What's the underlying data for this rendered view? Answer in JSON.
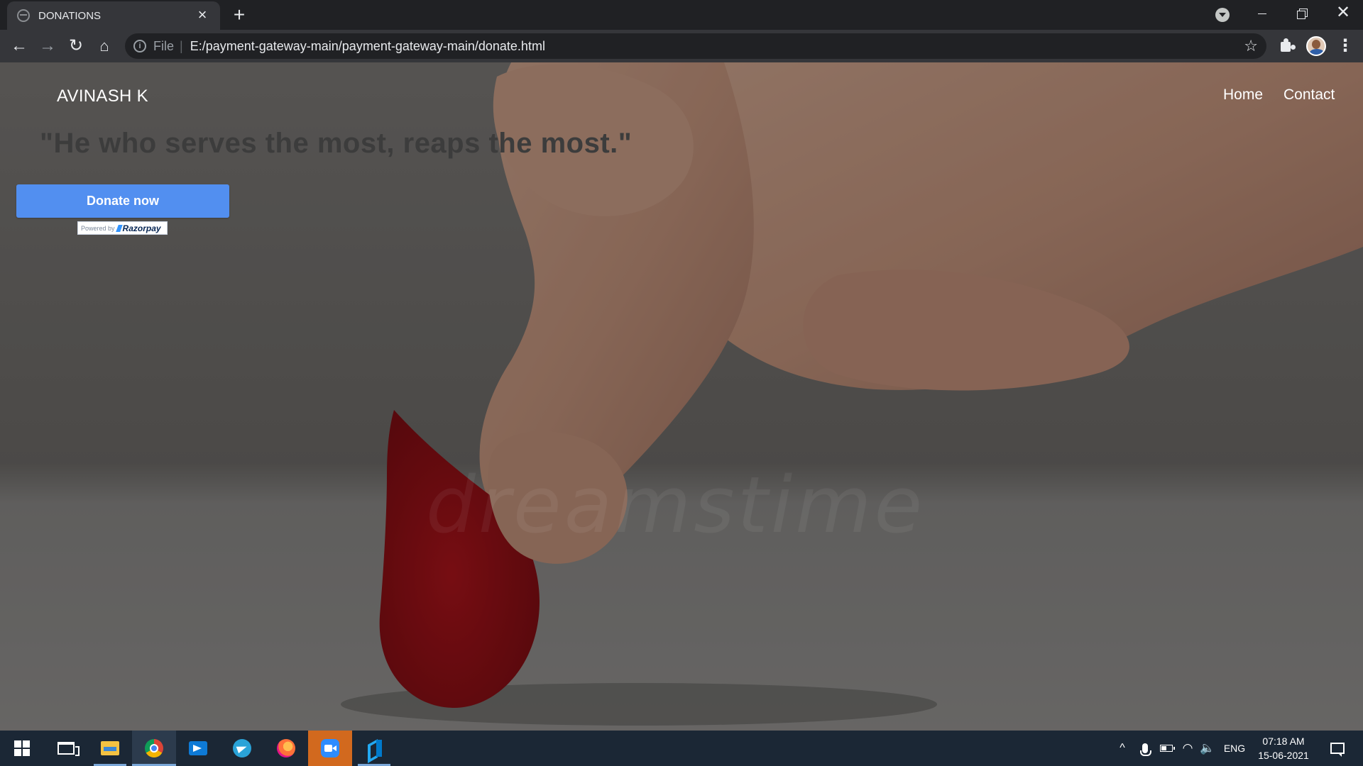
{
  "browser": {
    "tab": {
      "title": "DONATIONS",
      "close_glyph": "×"
    },
    "new_tab_glyph": "+",
    "omnibox": {
      "scheme_label": "File",
      "separator": "|",
      "url": "E:/payment-gateway-main/payment-gateway-main/donate.html"
    },
    "icons": {
      "back": "←",
      "forward": "→",
      "reload": "↻",
      "home": "⌂",
      "info": "i",
      "star": "☆",
      "menu": "⋮",
      "close": "✕"
    }
  },
  "page": {
    "brand": "AVINASH K",
    "nav": {
      "home": "Home",
      "contact": "Contact"
    },
    "quote": "\"He who serves the most, reaps the most.\"",
    "donate_button": "Donate now",
    "razorpay_badge": {
      "powered_by": "Powered by",
      "logo_text": "Razorpay"
    },
    "watermark": "dreamstime"
  },
  "taskbar": {
    "apps": [
      "start",
      "task-view",
      "file-explorer",
      "chrome",
      "remote-desktop",
      "telegram",
      "firefox",
      "zoom",
      "vscode"
    ],
    "active_app": "chrome",
    "tray": {
      "chevron": "^",
      "wifi_glyph": "◠",
      "volume_glyph": "🔈",
      "language": "ENG",
      "time": "07:18 AM",
      "date": "15-06-2021"
    }
  },
  "colors": {
    "donate_button": "#528ff0",
    "drop_red": "#a3131a",
    "taskbar": "#1b2735",
    "chrome_dark": "#202124"
  }
}
